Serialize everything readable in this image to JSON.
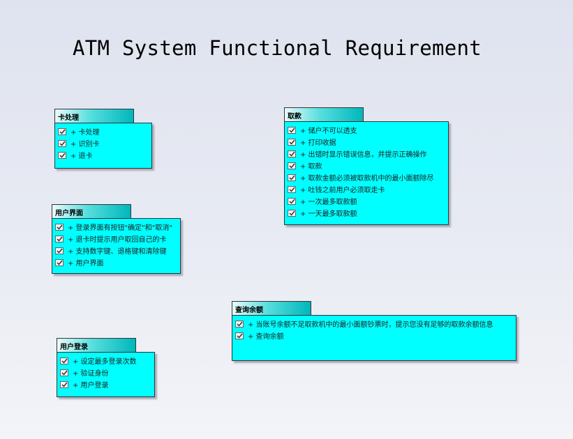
{
  "diagram": {
    "title": "ATM System Functional Requirement",
    "packages": [
      {
        "id": "card",
        "name": "卡处理",
        "items": [
          "+ 卡处理",
          "+ 识别卡",
          "+ 退卡"
        ]
      },
      {
        "id": "ui",
        "name": "用户界面",
        "items": [
          "+ 登录界面有按钮\"确定\"和\"取消\"",
          "+ 退卡时提示用户取回自己的卡",
          "+ 支持数字键、退格键和清除键",
          "+ 用户界面"
        ]
      },
      {
        "id": "login",
        "name": "用户登录",
        "items": [
          "+ 设定最多登录次数",
          "+ 验证身份",
          "+ 用户登录"
        ]
      },
      {
        "id": "withdraw",
        "name": "取款",
        "items": [
          "+ 储户不可以透支",
          "+ 打印收据",
          "+ 出错时显示错误信息，并提示正确操作",
          "+ 取款",
          "+ 取款金额必须被取款机中的最小面额除尽",
          "+ 吐钱之前用户必须取走卡",
          "+ 一次最多取款额",
          "+ 一天最多取款额"
        ]
      },
      {
        "id": "balance",
        "name": "查询余额",
        "items": [
          "+ 当账号余额不足取款机中的最小面额钞票时，提示您没有足够的取款余额信息",
          "+ 查询余额"
        ]
      }
    ]
  }
}
